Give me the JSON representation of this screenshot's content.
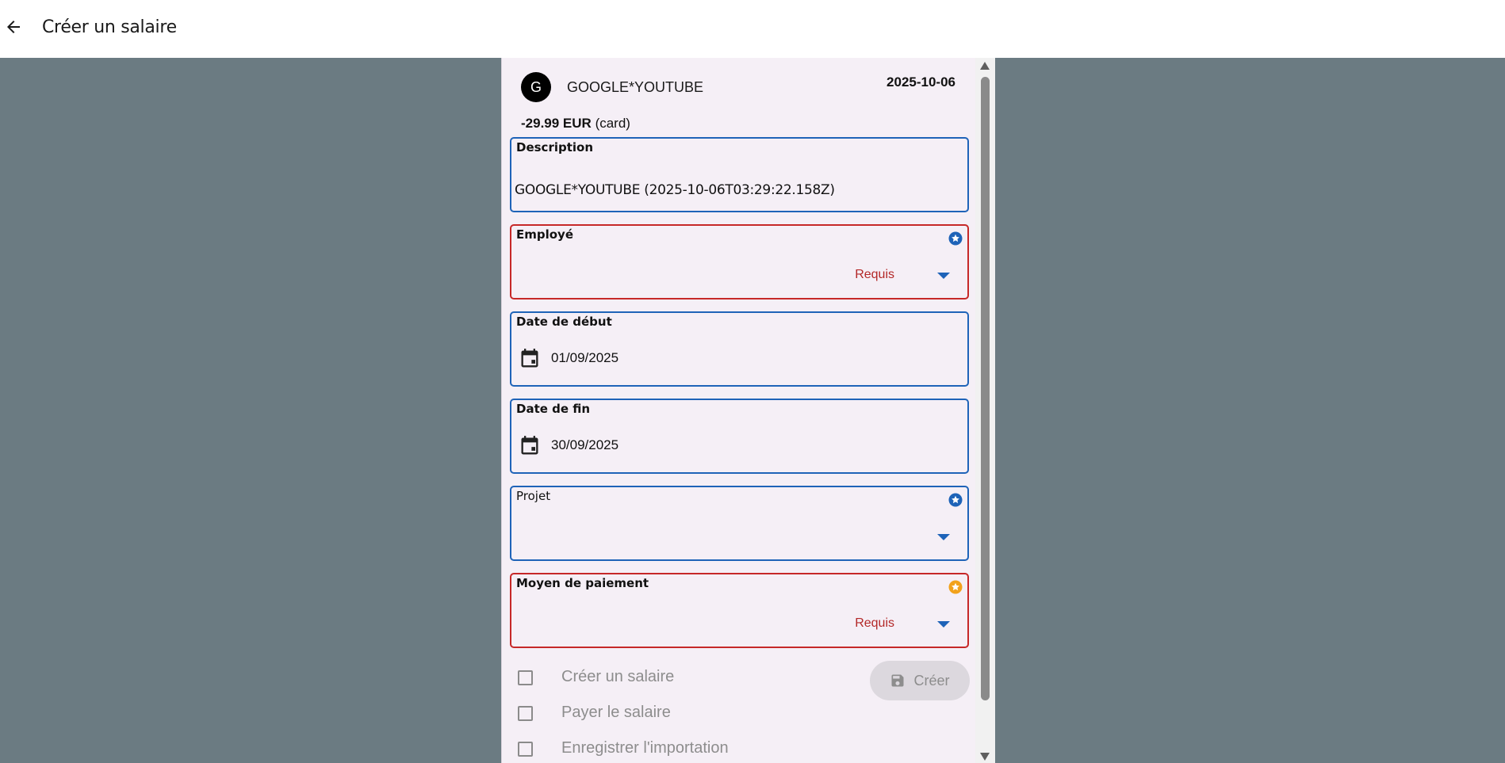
{
  "appbar": {
    "back_icon": "arrow-left-icon",
    "title": "Créer un salaire"
  },
  "transaction": {
    "avatar_letter": "G",
    "merchant": "GOOGLE*YOUTUBE",
    "date": "2025-10-06",
    "amount": "-29.99 EUR",
    "method": "(card)"
  },
  "fields": {
    "description": {
      "label": "Description",
      "value": "GOOGLE*YOUTUBE (2025-10-06T03:29:22.158Z)"
    },
    "employe": {
      "label": "Employé",
      "value": "",
      "error": "Requis",
      "star_color": "#1e63b8"
    },
    "date_debut": {
      "label": "Date de début",
      "value": "01/09/2025"
    },
    "date_fin": {
      "label": "Date de fin",
      "value": "30/09/2025"
    },
    "projet": {
      "label": "Projet",
      "value": "",
      "star_color": "#1e63b8"
    },
    "moyen_paiement": {
      "label": "Moyen de paiement",
      "value": "",
      "error": "Requis",
      "star_color": "#f2a21b"
    }
  },
  "checkboxes": [
    {
      "label": "Créer un salaire",
      "checked": false
    },
    {
      "label": "Payer le salaire",
      "checked": false
    },
    {
      "label": "Enregistrer l'importation",
      "checked": false
    }
  ],
  "actions": {
    "create_label": "Créer",
    "create_icon": "save-icon"
  },
  "colors": {
    "background": "#6b7b82",
    "panel": "#f5eff6",
    "accent": "#1e63b8",
    "error": "#c62828",
    "warning": "#f2a21b"
  }
}
